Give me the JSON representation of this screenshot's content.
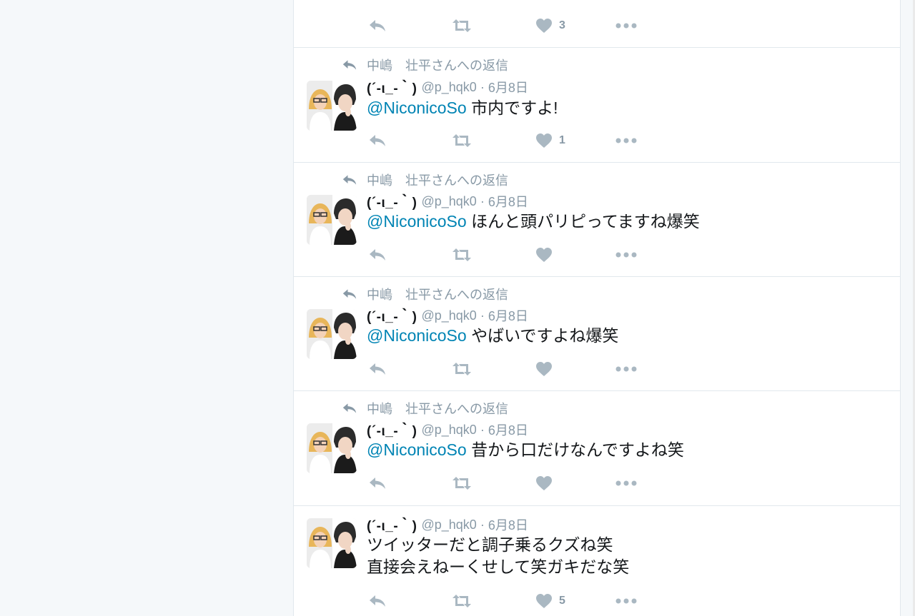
{
  "colors": {
    "background": "#f5f8fa",
    "mention": "#0084b4",
    "icon": "#aab8c2",
    "meta": "#8899a6"
  },
  "top_actions": {
    "like_count": "3"
  },
  "reply_context": "中嶋　壮平さんへの返信",
  "tweets": [
    {
      "name": "(´-ι_-｀)",
      "handle": "@p_hqk0",
      "separator": "·",
      "time": "6月8日",
      "mention": "@NiconicoSo",
      "text": "市内ですよ!",
      "like_count": "1"
    },
    {
      "name": "(´-ι_-｀)",
      "handle": "@p_hqk0",
      "separator": "·",
      "time": "6月8日",
      "mention": "@NiconicoSo",
      "text": "ほんと頭パリピってますね爆笑",
      "like_count": ""
    },
    {
      "name": "(´-ι_-｀)",
      "handle": "@p_hqk0",
      "separator": "·",
      "time": "6月8日",
      "mention": "@NiconicoSo",
      "text": "やばいですよね爆笑",
      "like_count": ""
    },
    {
      "name": "(´-ι_-｀)",
      "handle": "@p_hqk0",
      "separator": "·",
      "time": "6月8日",
      "mention": "@NiconicoSo",
      "text": "昔から口だけなんですよね笑",
      "like_count": ""
    },
    {
      "name": "(´-ι_-｀)",
      "handle": "@p_hqk0",
      "separator": "·",
      "time": "6月8日",
      "line1": "ツイッターだと調子乗るクズね笑",
      "line2": "直接会えねーくせして笑ガキだな笑",
      "like_count": "5"
    }
  ],
  "icons": {
    "reply": "reply-arrow-icon",
    "retweet": "retweet-icon",
    "like": "heart-icon",
    "more": "more-dots-icon",
    "context": "reply-context-icon"
  }
}
